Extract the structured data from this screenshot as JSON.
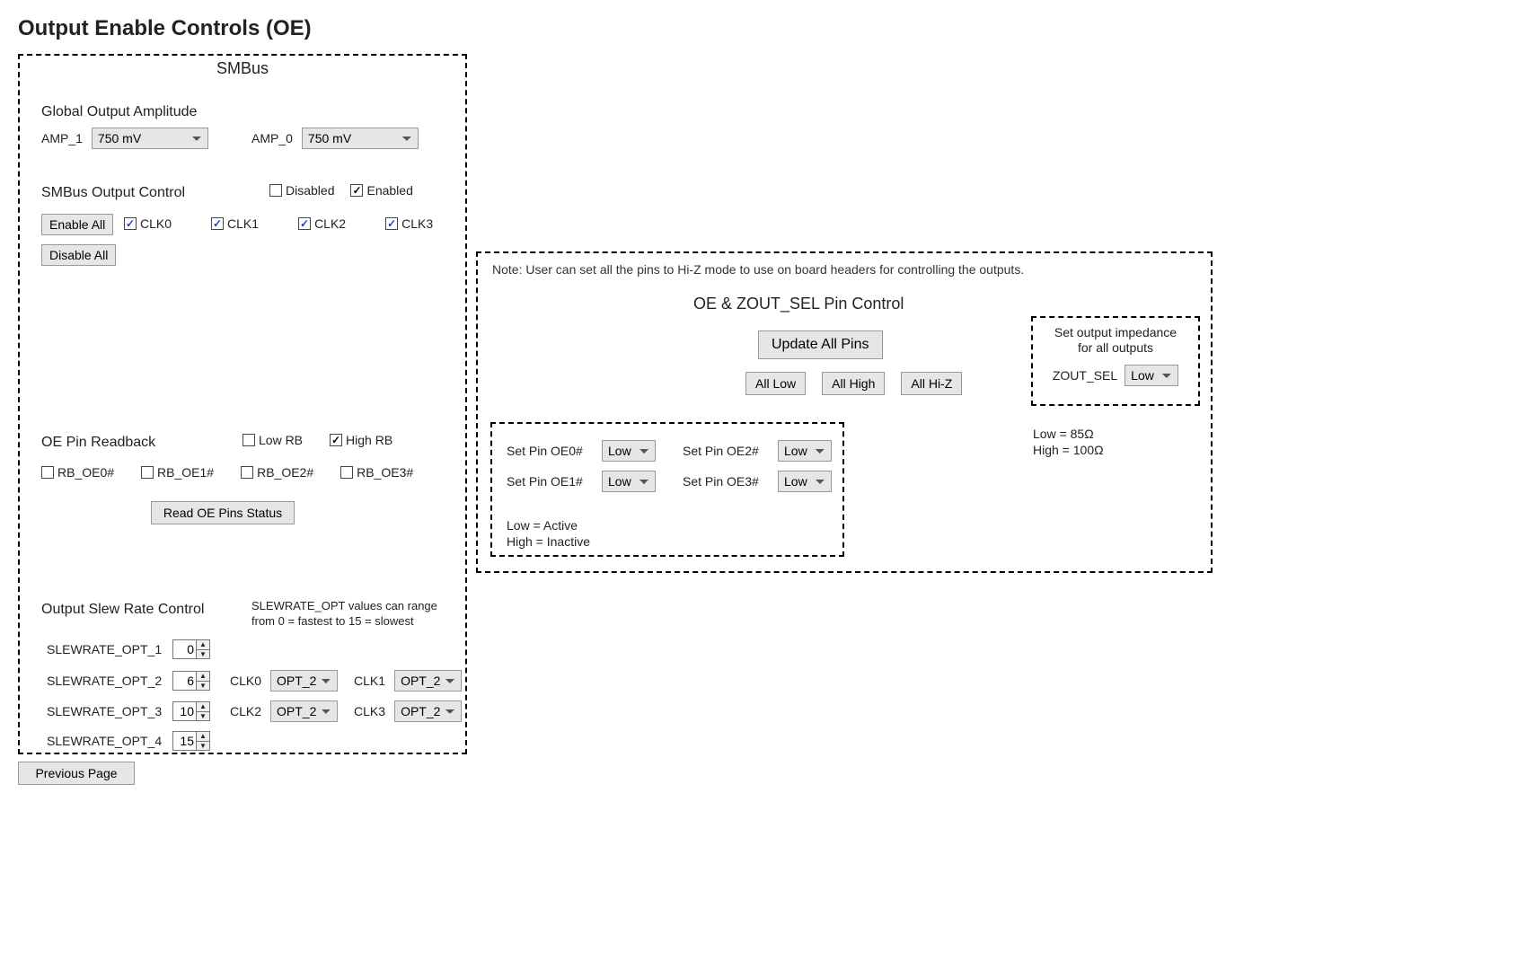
{
  "page": {
    "title": "Output Enable Controls (OE)",
    "previous_page": "Previous Page"
  },
  "smbus": {
    "panel_title": "SMBus",
    "global_amp_label": "Global Output Amplitude",
    "amp1_label": "AMP_1",
    "amp0_label": "AMP_0",
    "amp1_value": "750 mV",
    "amp0_value": "750 mV",
    "output_control_label": "SMBus Output Control",
    "legend_disabled": "Disabled",
    "legend_enabled": "Enabled",
    "enable_all": "Enable All",
    "disable_all": "Disable All",
    "clk0_label": "CLK0",
    "clk1_label": "CLK1",
    "clk2_label": "CLK2",
    "clk3_label": "CLK3",
    "clk0_checked": true,
    "clk1_checked": true,
    "clk2_checked": true,
    "clk3_checked": true
  },
  "readback": {
    "section_label": "OE Pin Readback",
    "low_rb_label": "Low RB",
    "high_rb_label": "High RB",
    "high_rb_checked": true,
    "rb_oe0_label": "RB_OE0#",
    "rb_oe1_label": "RB_OE1#",
    "rb_oe2_label": "RB_OE2#",
    "rb_oe3_label": "RB_OE3#",
    "read_btn": "Read OE Pins Status"
  },
  "slew": {
    "section_label": "Output Slew Rate Control",
    "help_line1": "SLEWRATE_OPT values can range",
    "help_line2": "from 0 = fastest to 15 = slowest",
    "opt1_label": "SLEWRATE_OPT_1",
    "opt2_label": "SLEWRATE_OPT_2",
    "opt3_label": "SLEWRATE_OPT_3",
    "opt4_label": "SLEWRATE_OPT_4",
    "opt1_value": "0",
    "opt2_value": "6",
    "opt3_value": "10",
    "opt4_value": "15",
    "clk0_label": "CLK0",
    "clk1_label": "CLK1",
    "clk2_label": "CLK2",
    "clk3_label": "CLK3",
    "clk0_value": "OPT_2",
    "clk1_value": "OPT_2",
    "clk2_value": "OPT_2",
    "clk3_value": "OPT_2"
  },
  "right": {
    "note": "Note: User can set all the pins to Hi-Z mode to use on board headers for controlling the outputs.",
    "pin_panel_title": "OE & ZOUT_SEL Pin Control",
    "update_all": "Update All Pins",
    "all_low": "All Low",
    "all_high": "All High",
    "all_hiz": "All Hi-Z",
    "set_pin0_label": "Set Pin OE0#",
    "set_pin1_label": "Set Pin OE1#",
    "set_pin2_label": "Set Pin OE2#",
    "set_pin3_label": "Set Pin OE3#",
    "set_pin0_value": "Low",
    "set_pin1_value": "Low",
    "set_pin2_value": "Low",
    "set_pin3_value": "Low",
    "legend_low": "Low = Active",
    "legend_high": "High = Inactive",
    "zout_box_line1": "Set output impedance",
    "zout_box_line2": "for all outputs",
    "zout_label": "ZOUT_SEL",
    "zout_value": "Low",
    "zout_low_line": "Low = 85Ω",
    "zout_high_line": "High = 100Ω"
  }
}
